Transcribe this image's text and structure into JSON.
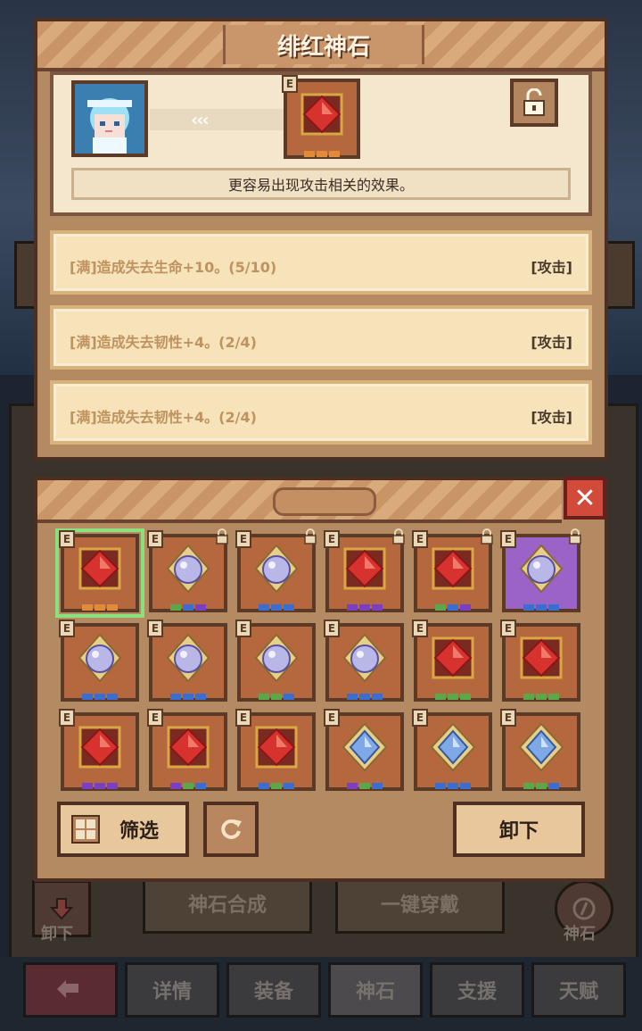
{
  "modal": {
    "title": "绯红神石",
    "arrows": "‹‹‹",
    "description": "更容易出现攻击相关的效果。",
    "effects": [
      {
        "text": "[满]造成失去生命+10。(5/10)",
        "tag": "[攻击]"
      },
      {
        "text": "[满]造成失去韧性+4。(2/4)",
        "tag": "[攻击]"
      },
      {
        "text": "[满]造成失去韧性+4。(2/4)",
        "tag": "[攻击]"
      }
    ]
  },
  "gem_panel": {
    "close_label": "✕",
    "filter_label": "筛选",
    "unload_label": "卸下",
    "badge_letter": "E",
    "gems": [
      {
        "type": "ruby",
        "dots": [
          "#e08a3a",
          "#e08a3a",
          "#e08a3a"
        ],
        "selected": true,
        "locked": false,
        "rare": false
      },
      {
        "type": "pearl",
        "dots": [
          "#5aa84a",
          "#3a6fd1",
          "#7a3fc4"
        ],
        "selected": false,
        "locked": true,
        "rare": false
      },
      {
        "type": "pearl",
        "dots": [
          "#3a6fd1",
          "#3a6fd1",
          "#3a6fd1"
        ],
        "selected": false,
        "locked": true,
        "rare": false
      },
      {
        "type": "ruby",
        "dots": [
          "#7a3fc4",
          "#7a3fc4",
          "#7a3fc4"
        ],
        "selected": false,
        "locked": true,
        "rare": false
      },
      {
        "type": "ruby",
        "dots": [
          "#5aa84a",
          "#3a6fd1",
          "#7a3fc4"
        ],
        "selected": false,
        "locked": true,
        "rare": false
      },
      {
        "type": "pearl",
        "dots": [
          "#3a6fd1",
          "#3a6fd1",
          "#3a6fd1"
        ],
        "selected": false,
        "locked": true,
        "rare": true
      },
      {
        "type": "pearl",
        "dots": [
          "#3a6fd1",
          "#3a6fd1",
          "#3a6fd1"
        ],
        "selected": false,
        "locked": false,
        "rare": false
      },
      {
        "type": "pearl",
        "dots": [
          "#3a6fd1",
          "#3a6fd1",
          "#3a6fd1"
        ],
        "selected": false,
        "locked": false,
        "rare": false
      },
      {
        "type": "pearl",
        "dots": [
          "#5aa84a",
          "#5aa84a",
          "#3a6fd1"
        ],
        "selected": false,
        "locked": false,
        "rare": false
      },
      {
        "type": "pearl",
        "dots": [
          "#3a6fd1",
          "#3a6fd1",
          "#3a6fd1"
        ],
        "selected": false,
        "locked": false,
        "rare": false
      },
      {
        "type": "ruby",
        "dots": [
          "#5aa84a",
          "#5aa84a",
          "#5aa84a"
        ],
        "selected": false,
        "locked": false,
        "rare": false
      },
      {
        "type": "ruby",
        "dots": [
          "#5aa84a",
          "#5aa84a",
          "#5aa84a"
        ],
        "selected": false,
        "locked": false,
        "rare": false
      },
      {
        "type": "ruby",
        "dots": [
          "#7a3fc4",
          "#7a3fc4",
          "#7a3fc4"
        ],
        "selected": false,
        "locked": false,
        "rare": false
      },
      {
        "type": "ruby",
        "dots": [
          "#7a3fc4",
          "#5aa84a",
          "#3a6fd1"
        ],
        "selected": false,
        "locked": false,
        "rare": false
      },
      {
        "type": "ruby",
        "dots": [
          "#3a6fd1",
          "#5aa84a",
          "#3a6fd1"
        ],
        "selected": false,
        "locked": false,
        "rare": false
      },
      {
        "type": "sapphire",
        "dots": [
          "#7a3fc4",
          "#5aa84a",
          "#3a6fd1"
        ],
        "selected": false,
        "locked": false,
        "rare": false
      },
      {
        "type": "sapphire",
        "dots": [
          "#3a6fd1",
          "#3a6fd1",
          "#3a6fd1"
        ],
        "selected": false,
        "locked": false,
        "rare": false
      },
      {
        "type": "sapphire",
        "dots": [
          "#5aa84a",
          "#5aa84a",
          "#3a6fd1"
        ],
        "selected": false,
        "locked": false,
        "rare": false
      }
    ]
  },
  "background": {
    "synth_label": "神石合成",
    "equip_all_label": "一键穿戴",
    "left_corner_label": "卸下",
    "right_corner_label": "神石"
  },
  "tabs": [
    "详情",
    "装备",
    "神石",
    "支援",
    "天赋"
  ],
  "colors": {
    "ruby": "#d8322f",
    "pearl": "#b9b6e8",
    "sapphire": "#7ea8e6",
    "accent_select": "#8ae07a"
  }
}
